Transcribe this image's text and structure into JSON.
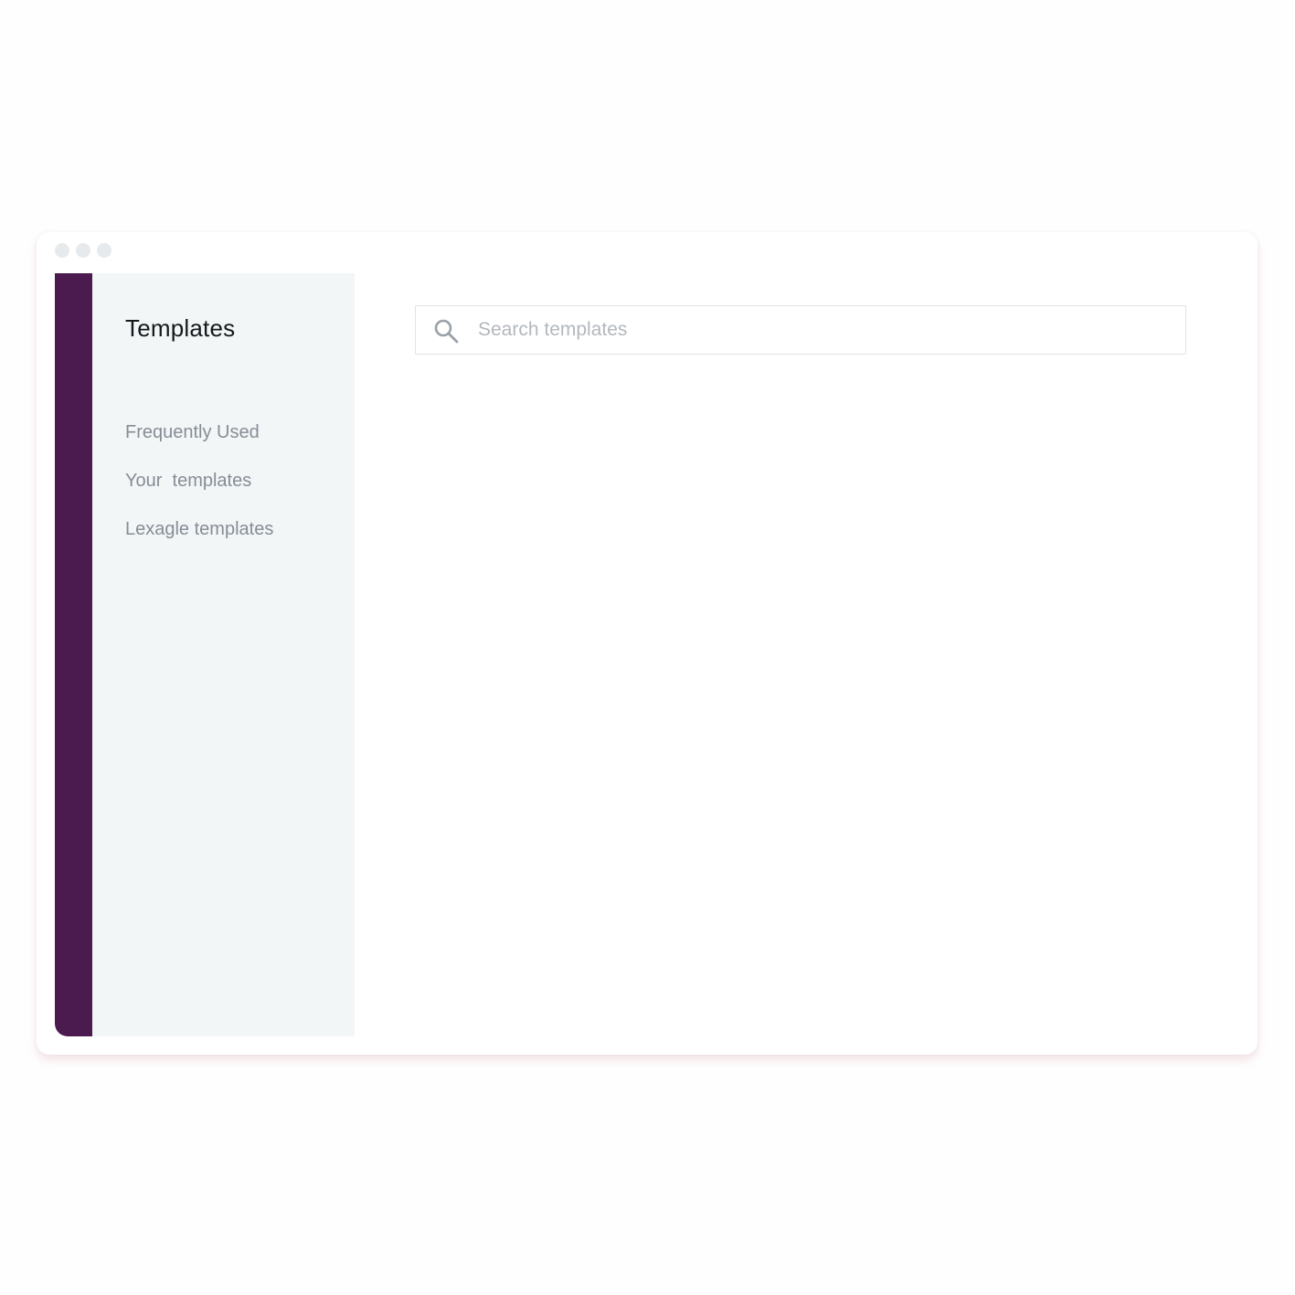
{
  "colors": {
    "rail": "#4b1a4e",
    "sidebar_bg": "#f3f6f7",
    "title_text": "#16191c",
    "nav_text": "#868d96",
    "placeholder_text": "#b3b8be",
    "window_dots": "#e6eaec"
  },
  "sidebar": {
    "title": "Templates",
    "items": [
      {
        "label": "Frequently Used"
      },
      {
        "label": "Your  templates"
      },
      {
        "label": "Lexagle templates"
      }
    ]
  },
  "search": {
    "icon": "search-icon",
    "value": "",
    "placeholder": "Search templates"
  }
}
